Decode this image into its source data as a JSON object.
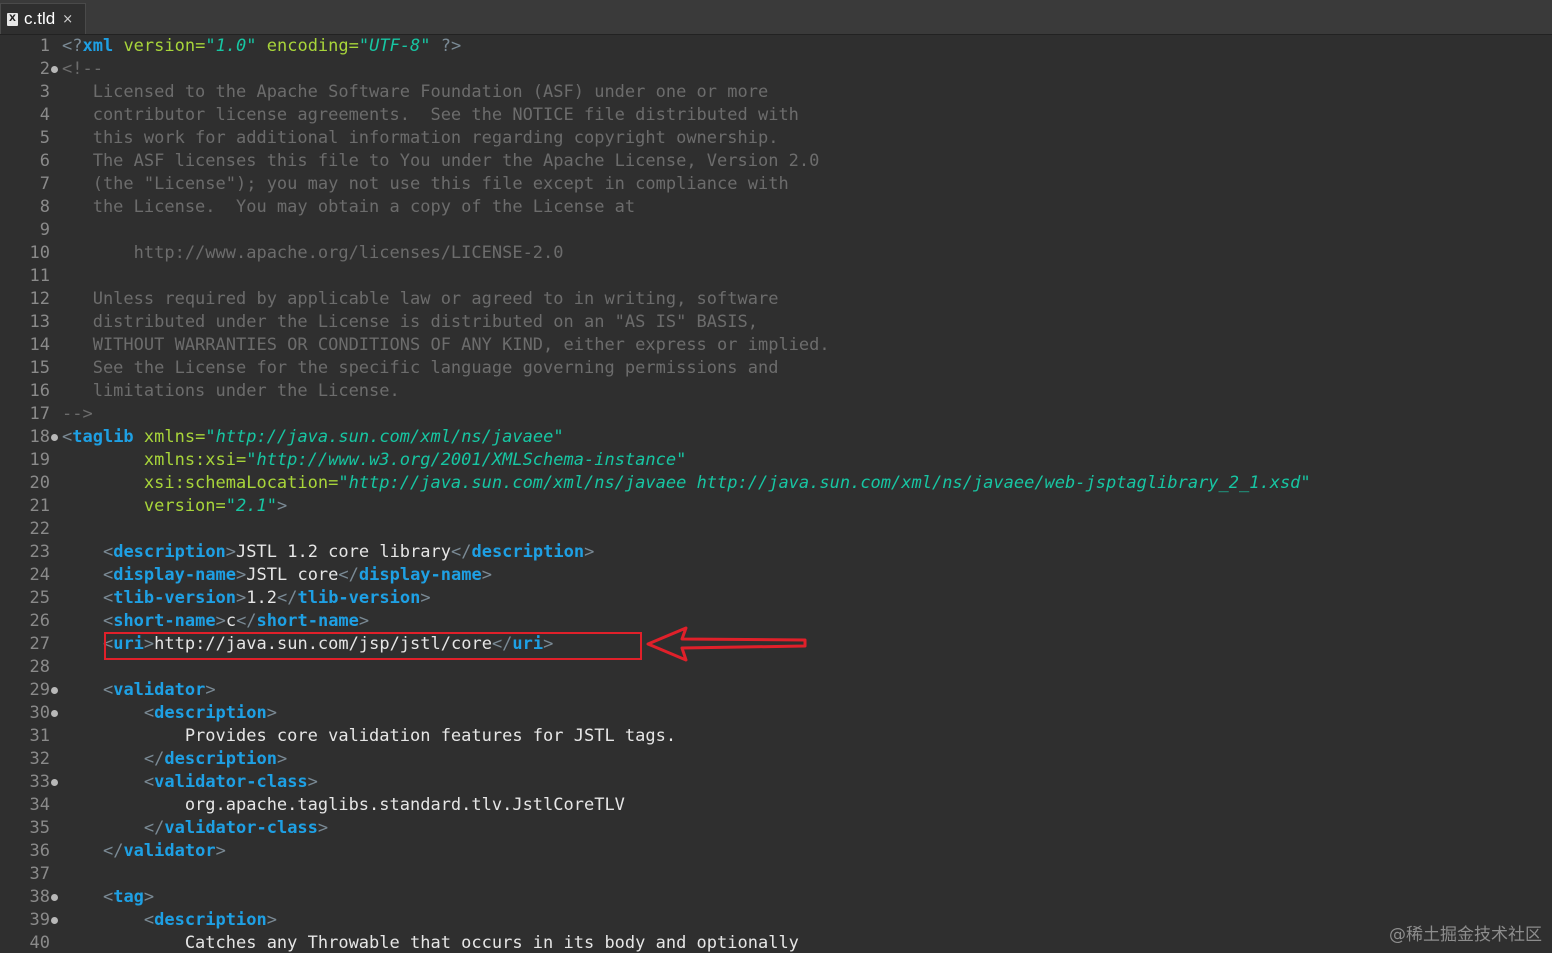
{
  "tab": {
    "icon": "xml-file-icon",
    "title": "c.tld",
    "close_glyph": "×"
  },
  "editor": {
    "lines": [
      {
        "n": "1",
        "fold": false,
        "parts": [
          [
            "p",
            "<?"
          ],
          [
            "t",
            "xml"
          ],
          [
            "a",
            " version="
          ],
          [
            "v",
            "\"1.0\""
          ],
          [
            "a",
            " encoding="
          ],
          [
            "v",
            "\"UTF-8\""
          ],
          [
            "p",
            " ?>"
          ]
        ]
      },
      {
        "n": "2",
        "fold": true,
        "parts": [
          [
            "c",
            "<!--"
          ]
        ]
      },
      {
        "n": "3",
        "fold": false,
        "parts": [
          [
            "c",
            "   Licensed to the Apache Software Foundation (ASF) under one or more"
          ]
        ]
      },
      {
        "n": "4",
        "fold": false,
        "parts": [
          [
            "c",
            "   contributor license agreements.  See the NOTICE file distributed with"
          ]
        ]
      },
      {
        "n": "5",
        "fold": false,
        "parts": [
          [
            "c",
            "   this work for additional information regarding copyright ownership."
          ]
        ]
      },
      {
        "n": "6",
        "fold": false,
        "parts": [
          [
            "c",
            "   The ASF licenses this file to You under the Apache License, Version 2.0"
          ]
        ]
      },
      {
        "n": "7",
        "fold": false,
        "parts": [
          [
            "c",
            "   (the \"License\"); you may not use this file except in compliance with"
          ]
        ]
      },
      {
        "n": "8",
        "fold": false,
        "parts": [
          [
            "c",
            "   the License.  You may obtain a copy of the License at"
          ]
        ]
      },
      {
        "n": "9",
        "fold": false,
        "parts": []
      },
      {
        "n": "10",
        "fold": false,
        "parts": [
          [
            "c",
            "       http://www.apache.org/licenses/LICENSE-2.0"
          ]
        ]
      },
      {
        "n": "11",
        "fold": false,
        "parts": []
      },
      {
        "n": "12",
        "fold": false,
        "parts": [
          [
            "c",
            "   Unless required by applicable law or agreed to in writing, software"
          ]
        ]
      },
      {
        "n": "13",
        "fold": false,
        "parts": [
          [
            "c",
            "   distributed under the License is distributed on an \"AS IS\" BASIS,"
          ]
        ]
      },
      {
        "n": "14",
        "fold": false,
        "parts": [
          [
            "c",
            "   WITHOUT WARRANTIES OR CONDITIONS OF ANY KIND, either express or implied."
          ]
        ]
      },
      {
        "n": "15",
        "fold": false,
        "parts": [
          [
            "c",
            "   See the License for the specific language governing permissions and"
          ]
        ]
      },
      {
        "n": "16",
        "fold": false,
        "parts": [
          [
            "c",
            "   limitations under the License."
          ]
        ]
      },
      {
        "n": "17",
        "fold": false,
        "parts": [
          [
            "c",
            "-->"
          ]
        ]
      },
      {
        "n": "18",
        "fold": true,
        "parts": [
          [
            "p",
            "<"
          ],
          [
            "t",
            "taglib"
          ],
          [
            "a",
            " xmlns="
          ],
          [
            "v",
            "\"http://java.sun.com/xml/ns/javaee\""
          ]
        ]
      },
      {
        "n": "19",
        "fold": false,
        "parts": [
          [
            "a",
            "        xmlns:xsi="
          ],
          [
            "v",
            "\"http://www.w3.org/2001/XMLSchema-instance\""
          ]
        ]
      },
      {
        "n": "20",
        "fold": false,
        "parts": [
          [
            "a",
            "        xsi:schemaLocation="
          ],
          [
            "v",
            "\"http://java.sun.com/xml/ns/javaee http://java.sun.com/xml/ns/javaee/web-jsptaglibrary_2_1.xsd\""
          ]
        ]
      },
      {
        "n": "21",
        "fold": false,
        "parts": [
          [
            "a",
            "        version="
          ],
          [
            "v",
            "\"2.1\""
          ],
          [
            "p",
            ">"
          ]
        ]
      },
      {
        "n": "22",
        "fold": false,
        "parts": []
      },
      {
        "n": "23",
        "fold": false,
        "parts": [
          [
            "x",
            "    "
          ],
          [
            "p",
            "<"
          ],
          [
            "t",
            "description"
          ],
          [
            "p",
            ">"
          ],
          [
            "x",
            "JSTL 1.2 core library"
          ],
          [
            "p",
            "</"
          ],
          [
            "t",
            "description"
          ],
          [
            "p",
            ">"
          ]
        ]
      },
      {
        "n": "24",
        "fold": false,
        "parts": [
          [
            "x",
            "    "
          ],
          [
            "p",
            "<"
          ],
          [
            "t",
            "display-name"
          ],
          [
            "p",
            ">"
          ],
          [
            "x",
            "JSTL core"
          ],
          [
            "p",
            "</"
          ],
          [
            "t",
            "display-name"
          ],
          [
            "p",
            ">"
          ]
        ]
      },
      {
        "n": "25",
        "fold": false,
        "parts": [
          [
            "x",
            "    "
          ],
          [
            "p",
            "<"
          ],
          [
            "t",
            "tlib-version"
          ],
          [
            "p",
            ">"
          ],
          [
            "x",
            "1.2"
          ],
          [
            "p",
            "</"
          ],
          [
            "t",
            "tlib-version"
          ],
          [
            "p",
            ">"
          ]
        ]
      },
      {
        "n": "26",
        "fold": false,
        "parts": [
          [
            "x",
            "    "
          ],
          [
            "p",
            "<"
          ],
          [
            "t",
            "short-name"
          ],
          [
            "p",
            ">"
          ],
          [
            "x",
            "c"
          ],
          [
            "p",
            "</"
          ],
          [
            "t",
            "short-name"
          ],
          [
            "p",
            ">"
          ]
        ]
      },
      {
        "n": "27",
        "fold": false,
        "parts": [
          [
            "x",
            "    "
          ],
          [
            "p",
            "<"
          ],
          [
            "t",
            "uri"
          ],
          [
            "p",
            ">"
          ],
          [
            "x",
            "http://java.sun.com/jsp/jstl/core"
          ],
          [
            "p",
            "</"
          ],
          [
            "t",
            "uri"
          ],
          [
            "p",
            ">"
          ]
        ]
      },
      {
        "n": "28",
        "fold": false,
        "parts": []
      },
      {
        "n": "29",
        "fold": true,
        "parts": [
          [
            "x",
            "    "
          ],
          [
            "p",
            "<"
          ],
          [
            "t",
            "validator"
          ],
          [
            "p",
            ">"
          ]
        ]
      },
      {
        "n": "30",
        "fold": true,
        "parts": [
          [
            "x",
            "        "
          ],
          [
            "p",
            "<"
          ],
          [
            "t",
            "description"
          ],
          [
            "p",
            ">"
          ]
        ]
      },
      {
        "n": "31",
        "fold": false,
        "parts": [
          [
            "x",
            "            Provides core validation features for JSTL tags."
          ]
        ]
      },
      {
        "n": "32",
        "fold": false,
        "parts": [
          [
            "x",
            "        "
          ],
          [
            "p",
            "</"
          ],
          [
            "t",
            "description"
          ],
          [
            "p",
            ">"
          ]
        ]
      },
      {
        "n": "33",
        "fold": true,
        "parts": [
          [
            "x",
            "        "
          ],
          [
            "p",
            "<"
          ],
          [
            "t",
            "validator-class"
          ],
          [
            "p",
            ">"
          ]
        ]
      },
      {
        "n": "34",
        "fold": false,
        "parts": [
          [
            "x",
            "            org.apache.taglibs.standard.tlv.JstlCoreTLV"
          ]
        ]
      },
      {
        "n": "35",
        "fold": false,
        "parts": [
          [
            "x",
            "        "
          ],
          [
            "p",
            "</"
          ],
          [
            "t",
            "validator-class"
          ],
          [
            "p",
            ">"
          ]
        ]
      },
      {
        "n": "36",
        "fold": false,
        "parts": [
          [
            "x",
            "    "
          ],
          [
            "p",
            "</"
          ],
          [
            "t",
            "validator"
          ],
          [
            "p",
            ">"
          ]
        ]
      },
      {
        "n": "37",
        "fold": false,
        "parts": []
      },
      {
        "n": "38",
        "fold": true,
        "parts": [
          [
            "x",
            "    "
          ],
          [
            "p",
            "<"
          ],
          [
            "t",
            "tag"
          ],
          [
            "p",
            ">"
          ]
        ]
      },
      {
        "n": "39",
        "fold": true,
        "parts": [
          [
            "x",
            "        "
          ],
          [
            "p",
            "<"
          ],
          [
            "t",
            "description"
          ],
          [
            "p",
            ">"
          ]
        ]
      },
      {
        "n": "40",
        "fold": false,
        "parts": [
          [
            "x",
            "            Catches any Throwable that occurs in its body and optionally"
          ]
        ]
      }
    ]
  },
  "annotation": {
    "highlighted_line": "27",
    "box_color": "#e0202a",
    "arrow_color": "#e0202a"
  },
  "watermark": "@稀土掘金技术社区",
  "colors": {
    "background": "#2f2f2f",
    "line_number": "#8a8a8a",
    "tag": "#1ea0e4",
    "attribute": "#a8d53a",
    "value": "#17c6a3",
    "text": "#e6e6e6",
    "comment": "#6c6c6c",
    "punctuation": "#7a8a95"
  }
}
